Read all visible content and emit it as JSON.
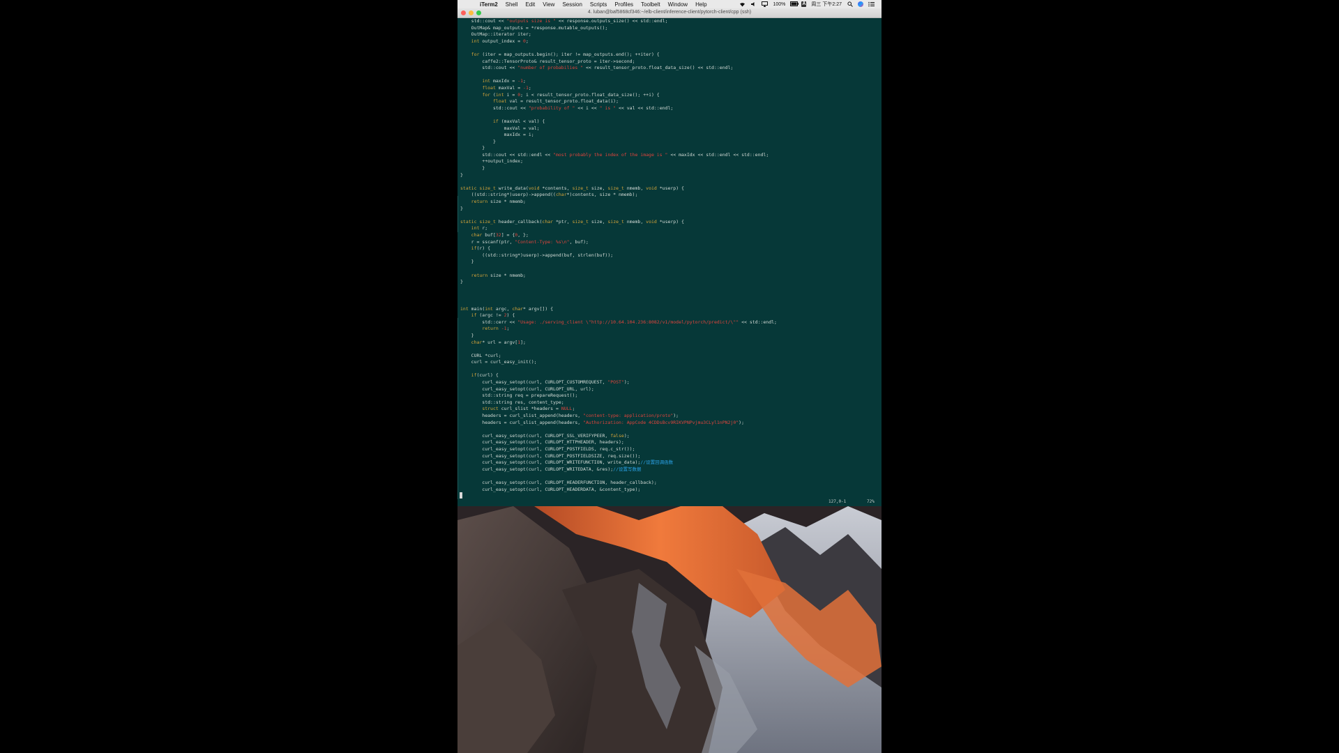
{
  "menubar": {
    "apple_glyph": "",
    "app_name": "iTerm2",
    "menus": [
      "Shell",
      "Edit",
      "View",
      "Session",
      "Scripts",
      "Profiles",
      "Toolbelt",
      "Window",
      "Help"
    ],
    "battery": "100%",
    "clock": "周三 下午2:27",
    "ime_label": "A"
  },
  "window": {
    "title": "4. luban@baf5868cf346:~/elb-client/inference-client/pytorch-client/cpp (ssh)"
  },
  "editor": {
    "status_position": "127,0-1",
    "status_percent": "72%",
    "lines": [
      [
        [
          "    std::cout << ",
          ""
        ],
        [
          "\"outputs size is \"",
          "st"
        ],
        [
          " << response.outputs_size() << std::endl;",
          ""
        ]
      ],
      [
        [
          "    OutMap& map_outputs = *response.mutable_outputs();",
          ""
        ]
      ],
      [
        [
          "    OutMap::iterator iter;",
          ""
        ]
      ],
      [
        [
          "    ",
          ""
        ],
        [
          "int",
          "kw"
        ],
        [
          " output_index = ",
          ""
        ],
        [
          "0",
          "nm"
        ],
        [
          ";",
          ""
        ]
      ],
      [
        [
          "",
          ""
        ]
      ],
      [
        [
          "    ",
          ""
        ],
        [
          "for",
          "kw"
        ],
        [
          " (iter = map_outputs.begin(); iter != map_outputs.end(); ++iter) {",
          ""
        ]
      ],
      [
        [
          "        caffe2::TensorProto& result_tensor_proto = iter->second;",
          ""
        ]
      ],
      [
        [
          "        std::cout << ",
          ""
        ],
        [
          "\"number of probabilies \"",
          "st"
        ],
        [
          " << result_tensor_proto.float_data_size() << std::endl;",
          ""
        ]
      ],
      [
        [
          "",
          ""
        ]
      ],
      [
        [
          "        ",
          ""
        ],
        [
          "int",
          "kw"
        ],
        [
          " maxIdx = ",
          ""
        ],
        [
          "-1",
          "nm"
        ],
        [
          ";",
          ""
        ]
      ],
      [
        [
          "        ",
          ""
        ],
        [
          "float",
          "kw"
        ],
        [
          " maxVal = ",
          ""
        ],
        [
          "-1",
          "nm"
        ],
        [
          ";",
          ""
        ]
      ],
      [
        [
          "        ",
          ""
        ],
        [
          "for",
          "kw"
        ],
        [
          " (",
          ""
        ],
        [
          "int",
          "kw"
        ],
        [
          " i = ",
          ""
        ],
        [
          "0",
          "nm"
        ],
        [
          "; i < result_tensor_proto.float_data_size(); ++i) {",
          ""
        ]
      ],
      [
        [
          "            ",
          ""
        ],
        [
          "float",
          "kw"
        ],
        [
          " val = result_tensor_proto.float_data(i);",
          ""
        ]
      ],
      [
        [
          "            std::cout << ",
          ""
        ],
        [
          "\"probability of \"",
          "st"
        ],
        [
          " << i << ",
          ""
        ],
        [
          "\" is \"",
          "st"
        ],
        [
          " << val << std::endl;",
          ""
        ]
      ],
      [
        [
          "",
          ""
        ]
      ],
      [
        [
          "            ",
          ""
        ],
        [
          "if",
          "kw"
        ],
        [
          " (maxVal < val) {",
          ""
        ]
      ],
      [
        [
          "                maxVal = val;",
          ""
        ]
      ],
      [
        [
          "                maxIdx = i;",
          ""
        ]
      ],
      [
        [
          "            }",
          ""
        ]
      ],
      [
        [
          "        }",
          ""
        ]
      ],
      [
        [
          "        std::cout << std::endl << ",
          ""
        ],
        [
          "\"most probably the index of the image is \"",
          "st"
        ],
        [
          " << maxIdx << std::endl << std::endl;",
          ""
        ]
      ],
      [
        [
          "        ++output_index;",
          ""
        ]
      ],
      [
        [
          "        }",
          ""
        ]
      ],
      [
        [
          "}",
          ""
        ]
      ],
      [
        [
          "",
          ""
        ]
      ],
      [
        [
          "static",
          "kw"
        ],
        [
          " ",
          ""
        ],
        [
          "size_t",
          "kw"
        ],
        [
          " write_data(",
          ""
        ],
        [
          "void",
          "kw"
        ],
        [
          " *contents, ",
          ""
        ],
        [
          "size_t",
          "kw"
        ],
        [
          " size, ",
          ""
        ],
        [
          "size_t",
          "kw"
        ],
        [
          " nmemb, ",
          ""
        ],
        [
          "void",
          "kw"
        ],
        [
          " *userp) {",
          ""
        ]
      ],
      [
        [
          "    ((std::string*)userp)->append((",
          ""
        ],
        [
          "char",
          "kw"
        ],
        [
          "*)contents, size * nmemb);",
          ""
        ]
      ],
      [
        [
          "    ",
          ""
        ],
        [
          "return",
          "kw"
        ],
        [
          " size * nmemb;",
          ""
        ]
      ],
      [
        [
          "}",
          ""
        ]
      ],
      [
        [
          "",
          ""
        ]
      ],
      [
        [
          "static",
          "kw"
        ],
        [
          " ",
          ""
        ],
        [
          "size_t",
          "kw"
        ],
        [
          " header_callback(",
          ""
        ],
        [
          "char",
          "kw"
        ],
        [
          " *ptr, ",
          ""
        ],
        [
          "size_t",
          "kw"
        ],
        [
          " size, ",
          ""
        ],
        [
          "size_t",
          "kw"
        ],
        [
          " nmemb, ",
          ""
        ],
        [
          "void",
          "kw"
        ],
        [
          " *userp) {",
          ""
        ]
      ],
      [
        [
          "    ",
          ""
        ],
        [
          "int",
          "kw"
        ],
        [
          " r;",
          ""
        ]
      ],
      [
        [
          "    ",
          ""
        ],
        [
          "char",
          "kw"
        ],
        [
          " buf[",
          ""
        ],
        [
          "32",
          "nm"
        ],
        [
          "] = {",
          ""
        ],
        [
          "0",
          "nm"
        ],
        [
          ", };",
          ""
        ]
      ],
      [
        [
          "    r = sscanf(ptr, ",
          ""
        ],
        [
          "\"Content-Type: %s\\n\"",
          "st"
        ],
        [
          ", buf);",
          ""
        ]
      ],
      [
        [
          "    ",
          ""
        ],
        [
          "if",
          "kw"
        ],
        [
          "(r) {",
          ""
        ]
      ],
      [
        [
          "        ((std::string*)userp)->append(buf, strlen(buf));",
          ""
        ]
      ],
      [
        [
          "    }",
          ""
        ]
      ],
      [
        [
          "",
          ""
        ]
      ],
      [
        [
          "    ",
          ""
        ],
        [
          "return",
          "kw"
        ],
        [
          " size * nmemb;",
          ""
        ]
      ],
      [
        [
          "}",
          ""
        ]
      ],
      [
        [
          "",
          ""
        ]
      ],
      [
        [
          "",
          ""
        ]
      ],
      [
        [
          "",
          ""
        ]
      ],
      [
        [
          "int",
          "kw"
        ],
        [
          " main(",
          ""
        ],
        [
          "int",
          "kw"
        ],
        [
          " argc, ",
          ""
        ],
        [
          "char",
          "kw"
        ],
        [
          "* argv[]) {",
          ""
        ]
      ],
      [
        [
          "    ",
          ""
        ],
        [
          "if",
          "kw"
        ],
        [
          " (argc != ",
          ""
        ],
        [
          "2",
          "nm"
        ],
        [
          ") {",
          ""
        ]
      ],
      [
        [
          "        std::cerr << ",
          ""
        ],
        [
          "\"Usage: ./serving_client \\\"http://10.64.104.236:8082/v1/model/pytorch/predict/\\\"\"",
          "st"
        ],
        [
          " << std::endl;",
          ""
        ]
      ],
      [
        [
          "        ",
          ""
        ],
        [
          "return",
          "kw"
        ],
        [
          " ",
          ""
        ],
        [
          "-1",
          "nm"
        ],
        [
          ";",
          ""
        ]
      ],
      [
        [
          "    }",
          ""
        ]
      ],
      [
        [
          "    ",
          ""
        ],
        [
          "char",
          "kw"
        ],
        [
          "* url = argv[",
          ""
        ],
        [
          "1",
          "nm"
        ],
        [
          "];",
          ""
        ]
      ],
      [
        [
          "",
          ""
        ]
      ],
      [
        [
          "    CURL *curl;",
          ""
        ]
      ],
      [
        [
          "    curl = curl_easy_init();",
          ""
        ]
      ],
      [
        [
          "",
          ""
        ]
      ],
      [
        [
          "    ",
          ""
        ],
        [
          "if",
          "kw"
        ],
        [
          "(curl) {",
          ""
        ]
      ],
      [
        [
          "        curl_easy_setopt(curl, CURLOPT_CUSTOMREQUEST, ",
          ""
        ],
        [
          "\"POST\"",
          "st"
        ],
        [
          ");",
          ""
        ]
      ],
      [
        [
          "        curl_easy_setopt(curl, CURLOPT_URL, url);",
          ""
        ]
      ],
      [
        [
          "        std::string req = prepareRequest();",
          ""
        ]
      ],
      [
        [
          "        std::string res, content_type;",
          ""
        ]
      ],
      [
        [
          "        ",
          ""
        ],
        [
          "struct",
          "kw"
        ],
        [
          " curl_slist *headers = ",
          ""
        ],
        [
          "NULL",
          "nm"
        ],
        [
          ";",
          ""
        ]
      ],
      [
        [
          "        headers = curl_slist_append(headers, ",
          ""
        ],
        [
          "\"content-type: application/proto\"",
          "st"
        ],
        [
          ");",
          ""
        ]
      ],
      [
        [
          "        headers = curl_slist_append(headers, ",
          ""
        ],
        [
          "\"Authorization: AppCode 4CDDsBcv9RIKVPNPvjmu3CLyl1nPN2j0\"",
          "st"
        ],
        [
          ");",
          ""
        ]
      ],
      [
        [
          "",
          ""
        ]
      ],
      [
        [
          "        curl_easy_setopt(curl, CURLOPT_SSL_VERIFYPEER, ",
          ""
        ],
        [
          "false",
          "kw"
        ],
        [
          ");",
          ""
        ]
      ],
      [
        [
          "        curl_easy_setopt(curl, CURLOPT_HTTPHEADER, headers);",
          ""
        ]
      ],
      [
        [
          "        curl_easy_setopt(curl, CURLOPT_POSTFIELDS, req.c_str());",
          ""
        ]
      ],
      [
        [
          "        curl_easy_setopt(curl, CURLOPT_POSTFIELDSIZE, req.size());",
          ""
        ]
      ],
      [
        [
          "        curl_easy_setopt(curl, CURLOPT_WRITEFUNCTION, write_data);",
          ""
        ],
        [
          "//设置回调函数",
          "cm"
        ]
      ],
      [
        [
          "        curl_easy_setopt(curl, CURLOPT_WRITEDATA, &res);",
          ""
        ],
        [
          "//设置写数据",
          "cm"
        ]
      ],
      [
        [
          "",
          ""
        ]
      ],
      [
        [
          "        curl_easy_setopt(curl, CURLOPT_HEADERFUNCTION, header_callback);",
          ""
        ]
      ],
      [
        [
          "        curl_easy_setopt(curl, CURLOPT_HEADERDATA, &content_type);",
          ""
        ]
      ]
    ]
  },
  "colors": {
    "terminal_bg": "#063838",
    "keyword": "#d6a53a",
    "string": "#e0443c",
    "comment": "#2aa1e6",
    "text": "#d3dbd6"
  },
  "wallpaper": {
    "name": "macOS Sierra mountain wallpaper"
  }
}
